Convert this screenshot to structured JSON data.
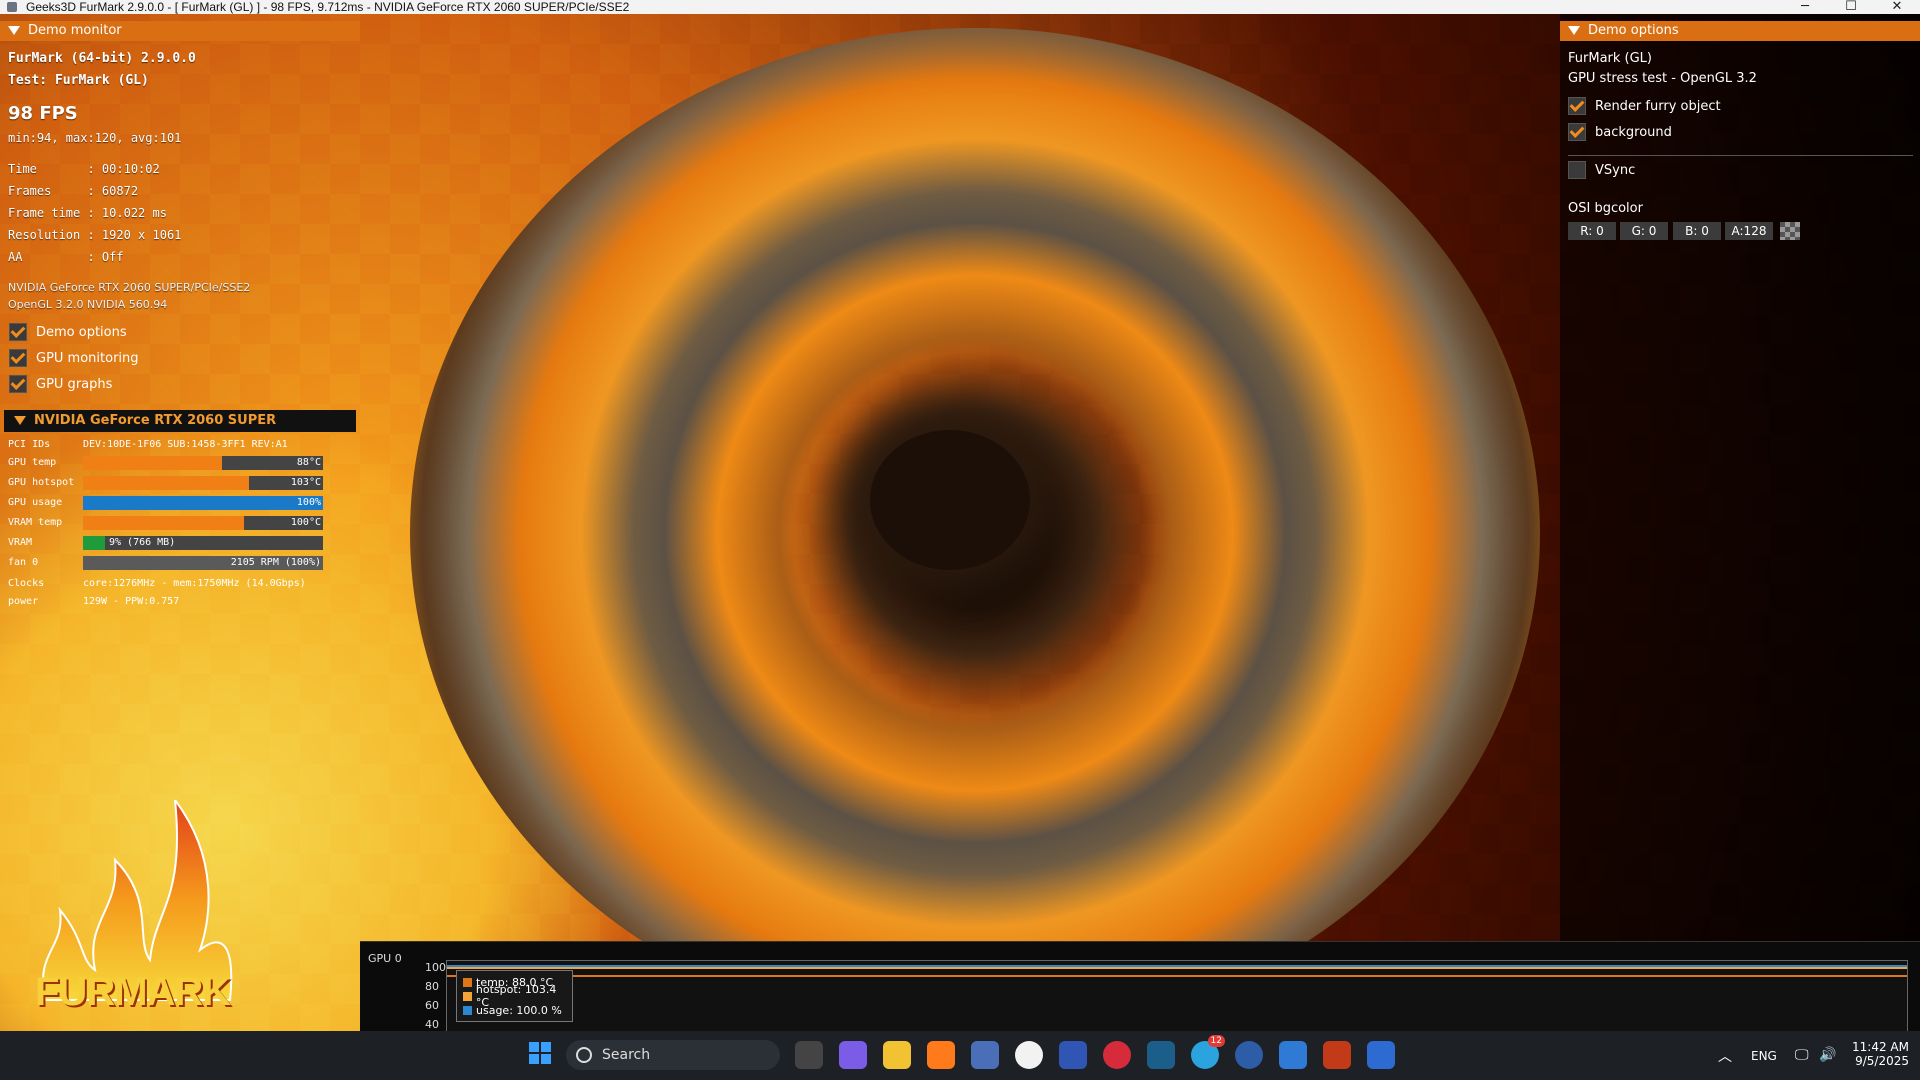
{
  "window": {
    "title": "Geeks3D FurMark 2.9.0.0 - [ FurMark (GL) ] - 98 FPS, 9.712ms - NVIDIA GeForce RTX 2060 SUPER/PCIe/SSE2",
    "min_glyph": "─",
    "max_glyph": "☐",
    "close_glyph": "✕"
  },
  "demo_monitor": {
    "header": "Demo monitor",
    "app_name": "FurMark (64-bit) 2.9.0.0",
    "test": "Test: FurMark (GL)",
    "fps": "98 FPS",
    "fps_stats": "min:94, max:120, avg:101",
    "time": "Time       : 00:10:02",
    "frames": "Frames     : 60872",
    "frame_time": "Frame time : 10.022 ms",
    "resolution": "Resolution : 1920 x 1061",
    "aa": "AA         : Off",
    "gpu_renderer": "NVIDIA GeForce RTX 2060 SUPER/PCIe/SSE2",
    "gl_version": "OpenGL 3.2.0 NVIDIA 560.94",
    "checkboxes": [
      {
        "label": "Demo options",
        "checked": true
      },
      {
        "label": "GPU monitoring",
        "checked": true
      },
      {
        "label": "GPU graphs",
        "checked": true
      }
    ]
  },
  "gpu_monitor": {
    "header": "NVIDIA GeForce RTX 2060 SUPER",
    "pci_label": "PCI IDs",
    "pci_value": "DEV:10DE-1F06 SUB:1458-3FF1 REV:A1",
    "gpu_temp": {
      "label": "GPU temp",
      "text": "88°C",
      "percent": 0.58,
      "color": "#f07f16"
    },
    "gpu_hotspot": {
      "label": "GPU hotspot",
      "text": "103°C",
      "percent": 0.69,
      "color": "#f07f16"
    },
    "gpu_usage": {
      "label": "GPU usage",
      "text": "100%",
      "percent": 1.0,
      "color": "#1a7ac8"
    },
    "vram_temp": {
      "label": "VRAM temp",
      "text": "100°C",
      "percent": 0.67,
      "color": "#f07f16"
    },
    "vram": {
      "label": "VRAM",
      "text": "9% (766 MB)",
      "percent": 0.09,
      "color": "#1f9b3b"
    },
    "fan": {
      "label": "fan 0",
      "text": "2105 RPM (100%)",
      "percent": 1.0,
      "color": "#5a5a5a"
    },
    "clocks_label": "Clocks",
    "clocks_value": "core:1276MHz - mem:1750MHz (14.0Gbps)",
    "power_label": "power",
    "power_value": "129W - PPW:0.757"
  },
  "logo_text": "FURMARK",
  "demo_options": {
    "header": "Demo options",
    "title": "FurMark (GL)",
    "subtitle": "GPU stress test - OpenGL 3.2",
    "render_furry": {
      "label": "Render furry object",
      "checked": true
    },
    "background": {
      "label": "background",
      "checked": true
    },
    "vsync": {
      "label": "VSync",
      "checked": false
    },
    "osi_label": "OSI bgcolor",
    "r": "R: 0",
    "g": "G: 0",
    "b": "B: 0",
    "a": "A:128"
  },
  "graph": {
    "title": "GPU 0",
    "y_ticks": [
      "100",
      "80",
      "60",
      "40"
    ],
    "legend": {
      "temp": "temp: 88.0 °C",
      "hotspot": "hotspot: 103.4 °C",
      "usage": "usage: 100.0 %"
    },
    "colors": {
      "temp": "#e0761a",
      "hotspot": "#f4a23a",
      "usage": "#2b88d1"
    }
  },
  "taskbar": {
    "search_placeholder": "Search",
    "lang": "ENG",
    "time": "11:42 AM",
    "date": "9/5/2025",
    "telegram_badge": "12"
  }
}
